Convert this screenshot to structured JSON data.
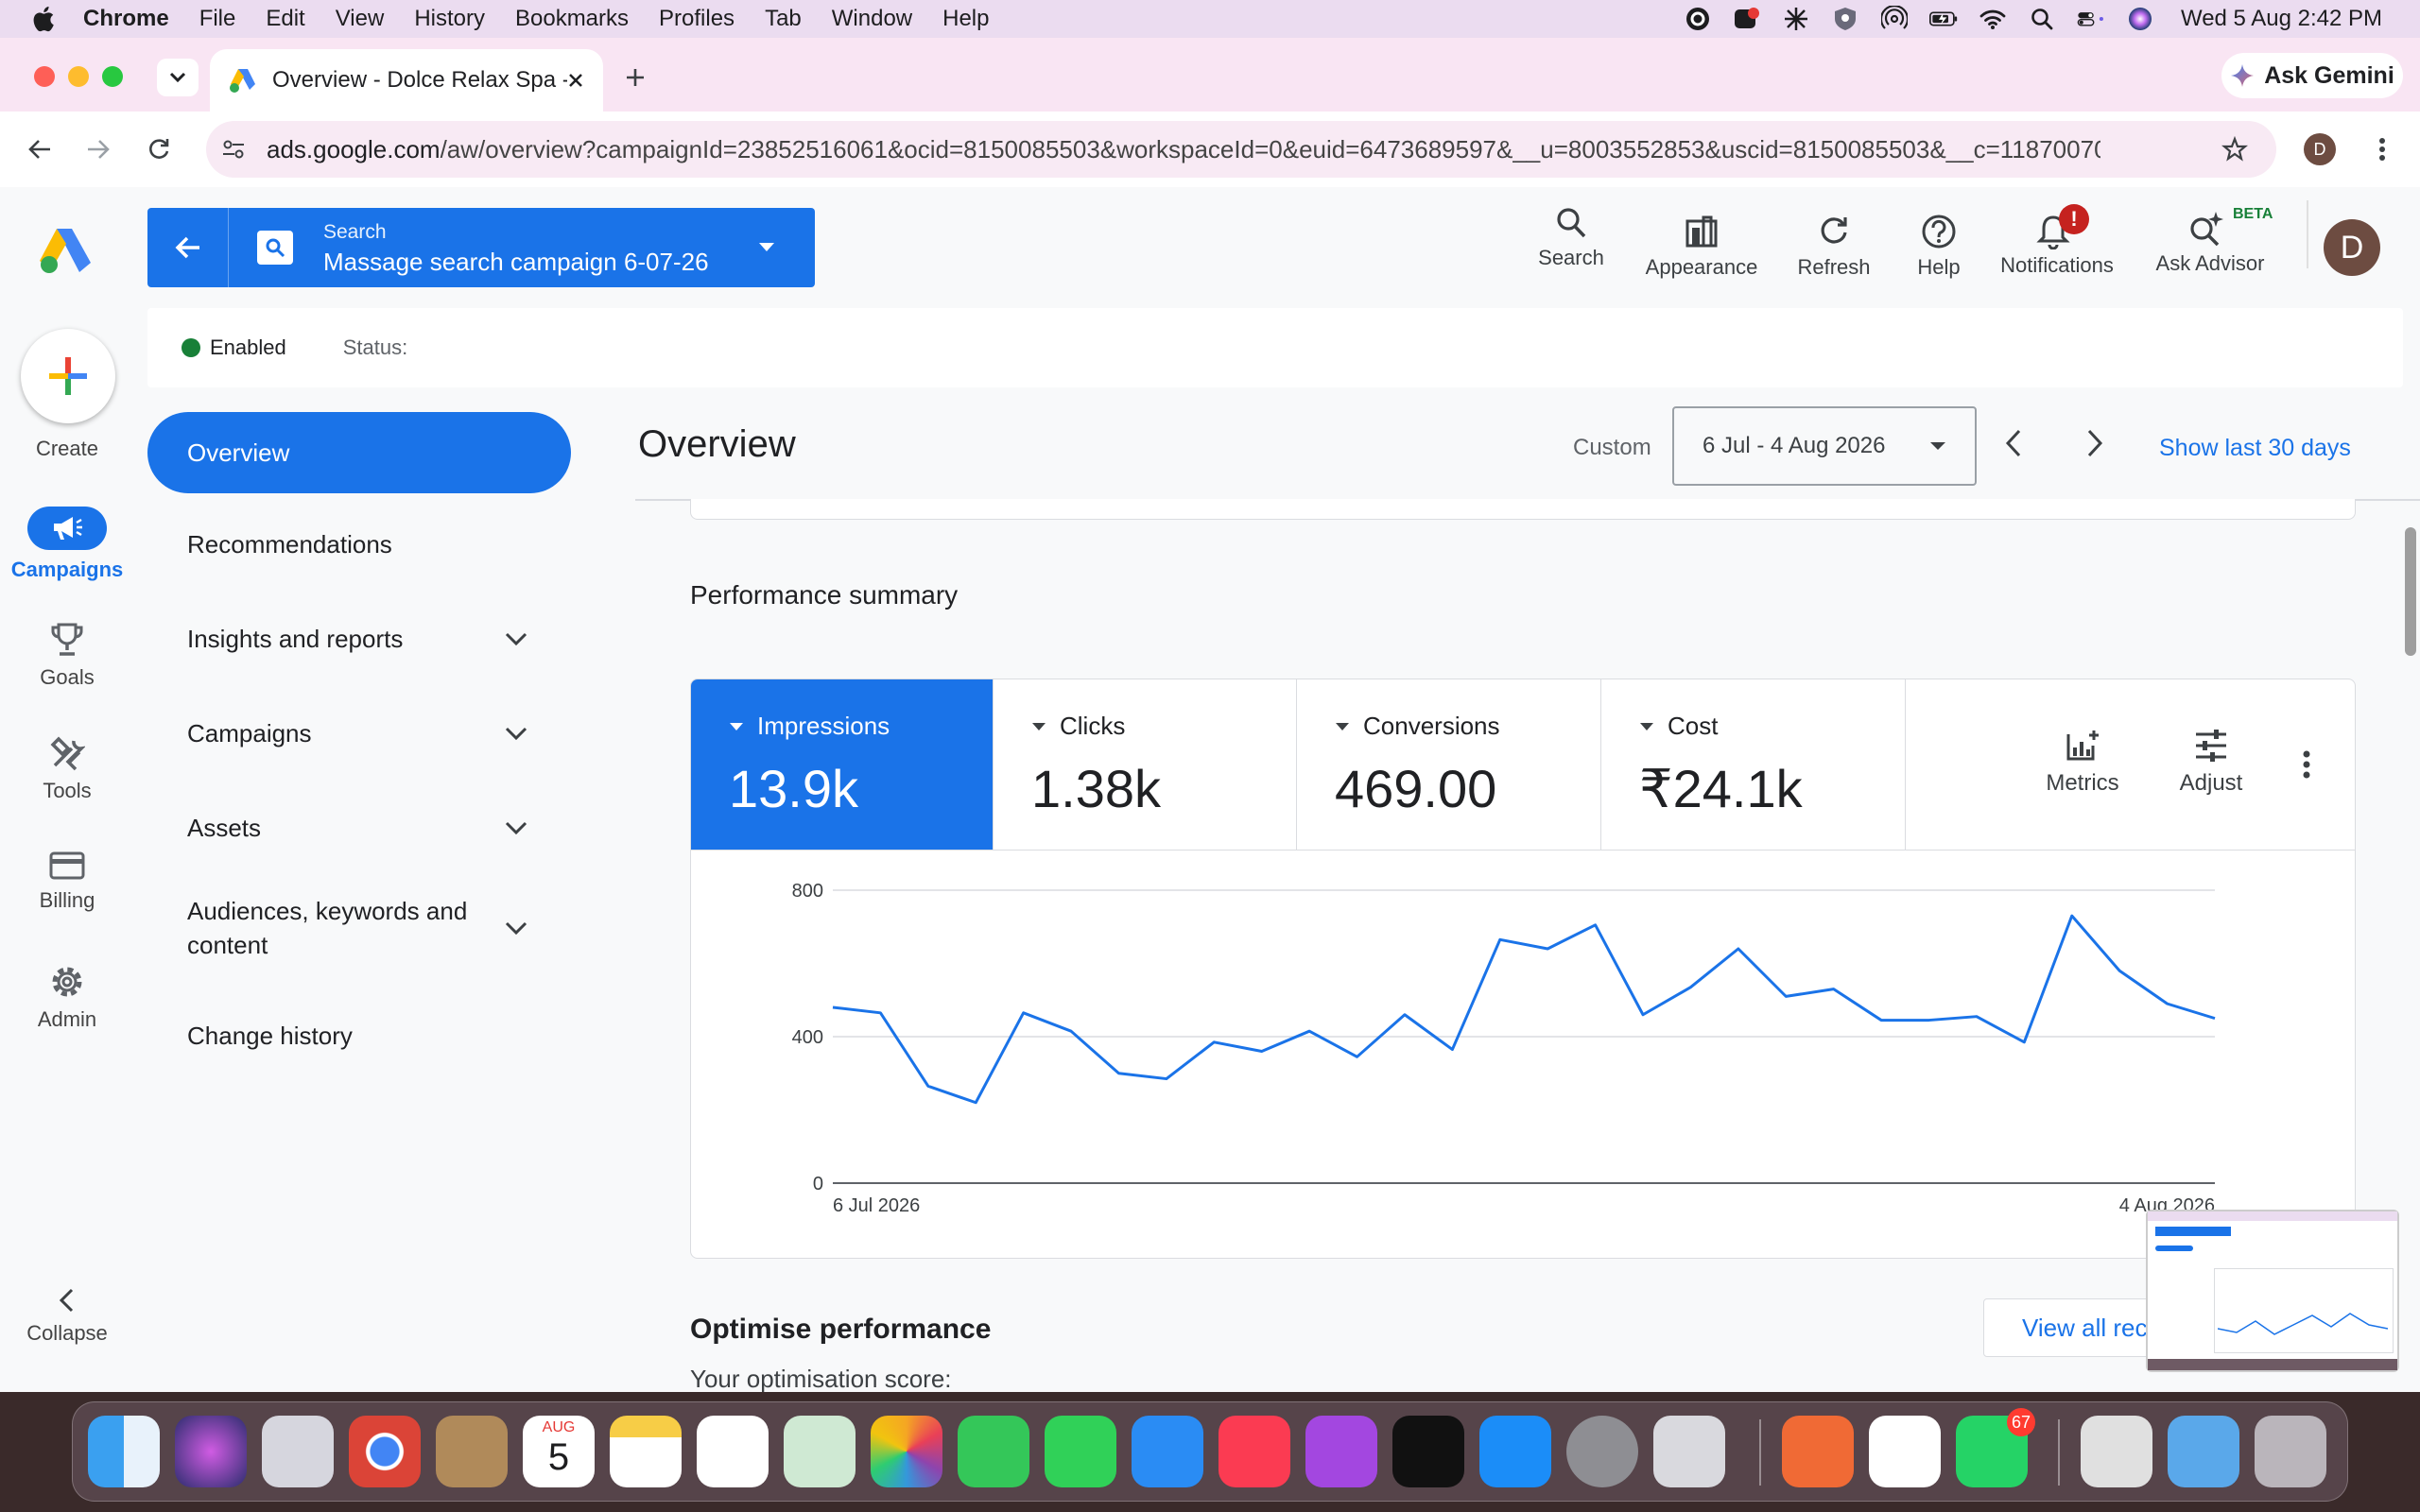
{
  "menubar": {
    "app": "Chrome",
    "items": [
      "File",
      "Edit",
      "View",
      "History",
      "Bookmarks",
      "Profiles",
      "Tab",
      "Window",
      "Help"
    ],
    "clock": "Wed 5 Aug  2:42 PM"
  },
  "browser": {
    "tab_title": "Overview - Dolce Relax Spa -",
    "ask_gemini": "Ask Gemini",
    "url_host": "ads.google.com",
    "url_path": "/aw/overview?campaignId=23852516061&ocid=8150085503&workspaceId=0&euid=6473689597&__u=8003552853&uscid=8150085503&__c=118700704...",
    "profile_initial": "D"
  },
  "ads": {
    "campaign_picker": {
      "label": "Search",
      "name": "Massage search campaign 6-07-26"
    },
    "top_actions": [
      {
        "label": "Search",
        "icon": "search-icon"
      },
      {
        "label": "Appearance",
        "icon": "appearance-icon"
      },
      {
        "label": "Refresh",
        "icon": "refresh-icon"
      },
      {
        "label": "Help",
        "icon": "help-icon"
      },
      {
        "label": "Notifications",
        "icon": "notifications-icon"
      },
      {
        "label": "Ask Advisor",
        "icon": "ask-advisor-icon"
      }
    ],
    "beta_badge": "BETA",
    "avatar_initial": "D",
    "status": {
      "enabled": "Enabled",
      "label": "Status:"
    },
    "left_nav": [
      {
        "label": "Create"
      },
      {
        "label": "Campaigns"
      },
      {
        "label": "Goals"
      },
      {
        "label": "Tools"
      },
      {
        "label": "Billing"
      },
      {
        "label": "Admin"
      }
    ],
    "collapse": "Collapse",
    "side_menu": [
      {
        "label": "Overview"
      },
      {
        "label": "Recommendations"
      },
      {
        "label": "Insights and reports"
      },
      {
        "label": "Campaigns"
      },
      {
        "label": "Assets"
      },
      {
        "label": "Audiences, keywords and content"
      },
      {
        "label": "Change history"
      }
    ],
    "page_title": "Overview",
    "date": {
      "custom": "Custom",
      "range": "6 Jul - 4 Aug 2026",
      "show_last": "Show last 30 days"
    },
    "performance_title": "Performance summary",
    "metrics": [
      {
        "label": "Impressions",
        "value": "13.9k"
      },
      {
        "label": "Clicks",
        "value": "1.38k"
      },
      {
        "label": "Conversions",
        "value": "469.00"
      },
      {
        "label": "Cost",
        "value": "₹24.1k"
      }
    ],
    "metrics_btn": "Metrics",
    "adjust_btn": "Adjust",
    "optimise_title": "Optimise performance",
    "optimise_score": "Your optimisation score:",
    "view_all": "View all rec"
  },
  "chart_data": {
    "type": "line",
    "series": [
      {
        "name": "Impressions",
        "values": [
          480,
          465,
          265,
          220,
          465,
          415,
          300,
          285,
          385,
          360,
          415,
          345,
          460,
          365,
          665,
          640,
          705,
          460,
          535,
          640,
          510,
          530,
          445,
          445,
          455,
          385,
          730,
          580,
          490,
          450
        ]
      }
    ],
    "x_start_label": "6 Jul 2026",
    "x_end_label": "4 Aug 2026",
    "yticks": [
      "0",
      "400",
      "800"
    ],
    "ylim": [
      0,
      800
    ],
    "grid": true,
    "color": "#1a73e8"
  },
  "dock": {
    "calendar_month": "AUG",
    "calendar_day": "5",
    "whatsapp_badge": "67"
  }
}
